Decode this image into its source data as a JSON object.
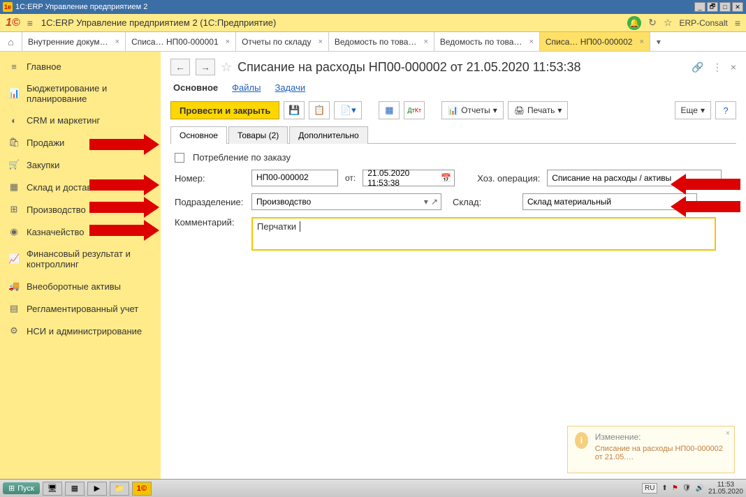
{
  "titlebar": {
    "title": "1C:ERP Управление предприятием 2"
  },
  "appheader": {
    "title": "1C:ERP Управление предприятием 2  (1С:Предприятие)",
    "user": "ERP-Consalt"
  },
  "tabs": [
    "Внутренние докум…",
    "Списа… НП00-000001",
    "Отчеты по складу",
    "Ведомость по това…",
    "Ведомость по това…",
    "Списа… НП00-000002"
  ],
  "sidebar": {
    "items": [
      "Главное",
      "Бюджетирование и планирование",
      "CRM и маркетинг",
      "Продажи",
      "Закупки",
      "Склад и доставка",
      "Производство",
      "Казначейство",
      "Финансовый результат и контроллинг",
      "Внеоборотные активы",
      "Регламентированный учет",
      "НСИ и администрирование"
    ]
  },
  "doc": {
    "title": "Списание на расходы НП00-000002 от 21.05.2020 11:53:38",
    "subtabs": {
      "main": "Основное",
      "files": "Файлы",
      "tasks": "Задачи"
    },
    "toolbar": {
      "post_close": "Провести и закрыть",
      "reports": "Отчеты",
      "print": "Печать",
      "more": "Еще"
    },
    "inner_tabs": {
      "main": "Основное",
      "goods": "Товары (2)",
      "extra": "Дополнительно"
    },
    "form": {
      "by_order": "Потребление по заказу",
      "number_label": "Номер:",
      "number": "НП00-000002",
      "from": "от:",
      "date": "21.05.2020 11:53:38",
      "op_label": "Хоз. операция:",
      "operation": "Списание на расходы / активы",
      "dept_label": "Подразделение:",
      "department": "Производство",
      "wh_label": "Склад:",
      "warehouse": "Склад материальный",
      "comment_label": "Комментарий:",
      "comment": "Перчатки"
    }
  },
  "toast": {
    "title": "Изменение:",
    "body": "Списание на расходы НП00-000002 от 21.05.…"
  },
  "taskbar": {
    "start": "Пуск",
    "lang": "RU",
    "time": "11:53",
    "date": "21.05.2020"
  }
}
